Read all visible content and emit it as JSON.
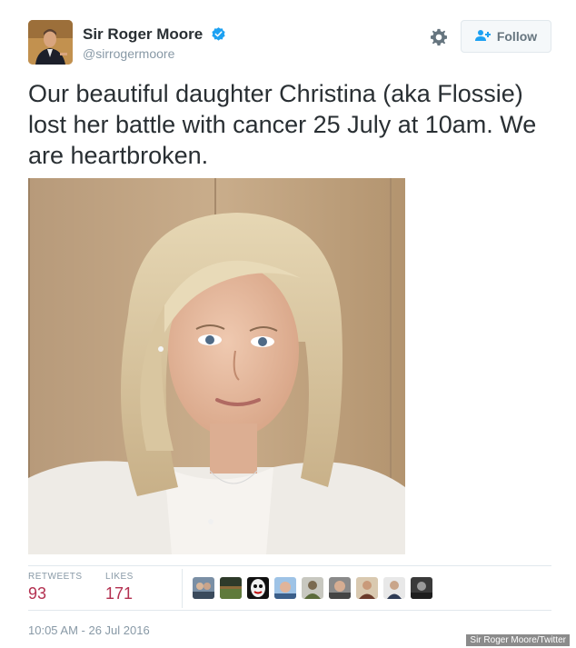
{
  "user": {
    "name": "Sir Roger Moore",
    "handle": "@sirrogermoore",
    "verified": true
  },
  "actions": {
    "settings_icon": "gear-icon",
    "follow_label": "Follow",
    "follow_icon": "add-user-icon"
  },
  "tweet": {
    "text": "Our beautiful daughter Christina (aka Flossie) lost her battle with cancer 25 July at 10am. We are heartbroken."
  },
  "stats": {
    "retweets_label": "RETWEETS",
    "retweets_value": "93",
    "likes_label": "LIKES",
    "likes_value": "171"
  },
  "timestamp": "10:05 AM - 26 Jul 2016",
  "credit": "Sir Roger Moore/Twitter",
  "colors": {
    "verified": "#1da1f2",
    "stat_value": "#b33050",
    "muted": "#8899a6"
  }
}
